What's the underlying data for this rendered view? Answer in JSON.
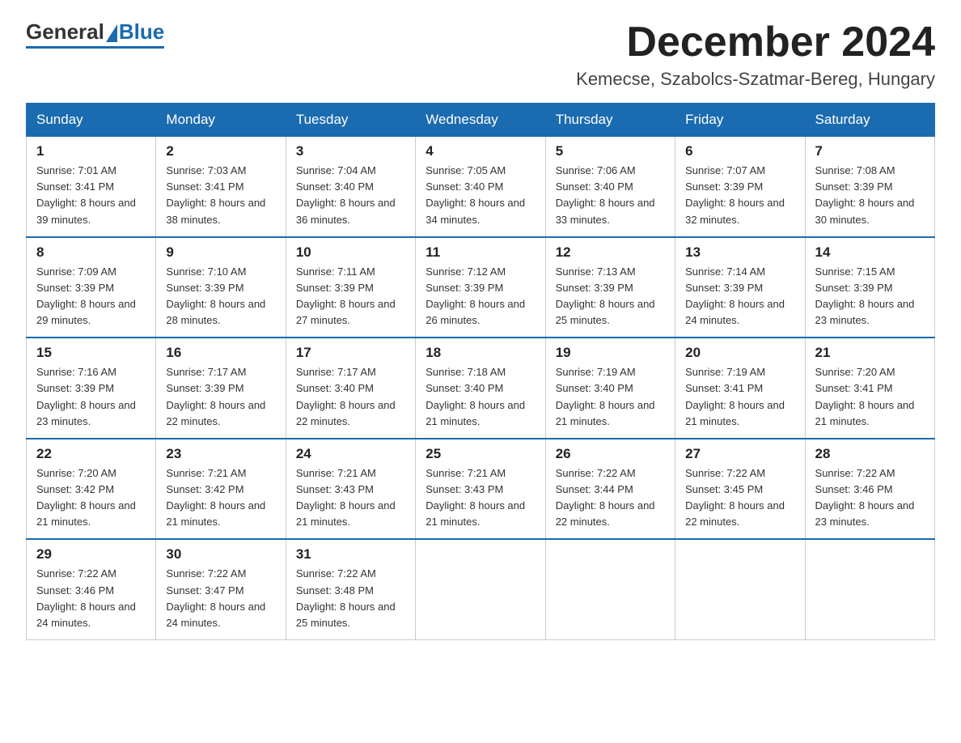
{
  "logo": {
    "general": "General",
    "blue": "Blue"
  },
  "header": {
    "month_title": "December 2024",
    "subtitle": "Kemecse, Szabolcs-Szatmar-Bereg, Hungary"
  },
  "columns": [
    "Sunday",
    "Monday",
    "Tuesday",
    "Wednesday",
    "Thursday",
    "Friday",
    "Saturday"
  ],
  "weeks": [
    [
      {
        "day": "1",
        "sunrise": "7:01 AM",
        "sunset": "3:41 PM",
        "daylight": "8 hours and 39 minutes."
      },
      {
        "day": "2",
        "sunrise": "7:03 AM",
        "sunset": "3:41 PM",
        "daylight": "8 hours and 38 minutes."
      },
      {
        "day": "3",
        "sunrise": "7:04 AM",
        "sunset": "3:40 PM",
        "daylight": "8 hours and 36 minutes."
      },
      {
        "day": "4",
        "sunrise": "7:05 AM",
        "sunset": "3:40 PM",
        "daylight": "8 hours and 34 minutes."
      },
      {
        "day": "5",
        "sunrise": "7:06 AM",
        "sunset": "3:40 PM",
        "daylight": "8 hours and 33 minutes."
      },
      {
        "day": "6",
        "sunrise": "7:07 AM",
        "sunset": "3:39 PM",
        "daylight": "8 hours and 32 minutes."
      },
      {
        "day": "7",
        "sunrise": "7:08 AM",
        "sunset": "3:39 PM",
        "daylight": "8 hours and 30 minutes."
      }
    ],
    [
      {
        "day": "8",
        "sunrise": "7:09 AM",
        "sunset": "3:39 PM",
        "daylight": "8 hours and 29 minutes."
      },
      {
        "day": "9",
        "sunrise": "7:10 AM",
        "sunset": "3:39 PM",
        "daylight": "8 hours and 28 minutes."
      },
      {
        "day": "10",
        "sunrise": "7:11 AM",
        "sunset": "3:39 PM",
        "daylight": "8 hours and 27 minutes."
      },
      {
        "day": "11",
        "sunrise": "7:12 AM",
        "sunset": "3:39 PM",
        "daylight": "8 hours and 26 minutes."
      },
      {
        "day": "12",
        "sunrise": "7:13 AM",
        "sunset": "3:39 PM",
        "daylight": "8 hours and 25 minutes."
      },
      {
        "day": "13",
        "sunrise": "7:14 AM",
        "sunset": "3:39 PM",
        "daylight": "8 hours and 24 minutes."
      },
      {
        "day": "14",
        "sunrise": "7:15 AM",
        "sunset": "3:39 PM",
        "daylight": "8 hours and 23 minutes."
      }
    ],
    [
      {
        "day": "15",
        "sunrise": "7:16 AM",
        "sunset": "3:39 PM",
        "daylight": "8 hours and 23 minutes."
      },
      {
        "day": "16",
        "sunrise": "7:17 AM",
        "sunset": "3:39 PM",
        "daylight": "8 hours and 22 minutes."
      },
      {
        "day": "17",
        "sunrise": "7:17 AM",
        "sunset": "3:40 PM",
        "daylight": "8 hours and 22 minutes."
      },
      {
        "day": "18",
        "sunrise": "7:18 AM",
        "sunset": "3:40 PM",
        "daylight": "8 hours and 21 minutes."
      },
      {
        "day": "19",
        "sunrise": "7:19 AM",
        "sunset": "3:40 PM",
        "daylight": "8 hours and 21 minutes."
      },
      {
        "day": "20",
        "sunrise": "7:19 AM",
        "sunset": "3:41 PM",
        "daylight": "8 hours and 21 minutes."
      },
      {
        "day": "21",
        "sunrise": "7:20 AM",
        "sunset": "3:41 PM",
        "daylight": "8 hours and 21 minutes."
      }
    ],
    [
      {
        "day": "22",
        "sunrise": "7:20 AM",
        "sunset": "3:42 PM",
        "daylight": "8 hours and 21 minutes."
      },
      {
        "day": "23",
        "sunrise": "7:21 AM",
        "sunset": "3:42 PM",
        "daylight": "8 hours and 21 minutes."
      },
      {
        "day": "24",
        "sunrise": "7:21 AM",
        "sunset": "3:43 PM",
        "daylight": "8 hours and 21 minutes."
      },
      {
        "day": "25",
        "sunrise": "7:21 AM",
        "sunset": "3:43 PM",
        "daylight": "8 hours and 21 minutes."
      },
      {
        "day": "26",
        "sunrise": "7:22 AM",
        "sunset": "3:44 PM",
        "daylight": "8 hours and 22 minutes."
      },
      {
        "day": "27",
        "sunrise": "7:22 AM",
        "sunset": "3:45 PM",
        "daylight": "8 hours and 22 minutes."
      },
      {
        "day": "28",
        "sunrise": "7:22 AM",
        "sunset": "3:46 PM",
        "daylight": "8 hours and 23 minutes."
      }
    ],
    [
      {
        "day": "29",
        "sunrise": "7:22 AM",
        "sunset": "3:46 PM",
        "daylight": "8 hours and 24 minutes."
      },
      {
        "day": "30",
        "sunrise": "7:22 AM",
        "sunset": "3:47 PM",
        "daylight": "8 hours and 24 minutes."
      },
      {
        "day": "31",
        "sunrise": "7:22 AM",
        "sunset": "3:48 PM",
        "daylight": "8 hours and 25 minutes."
      },
      null,
      null,
      null,
      null
    ]
  ]
}
